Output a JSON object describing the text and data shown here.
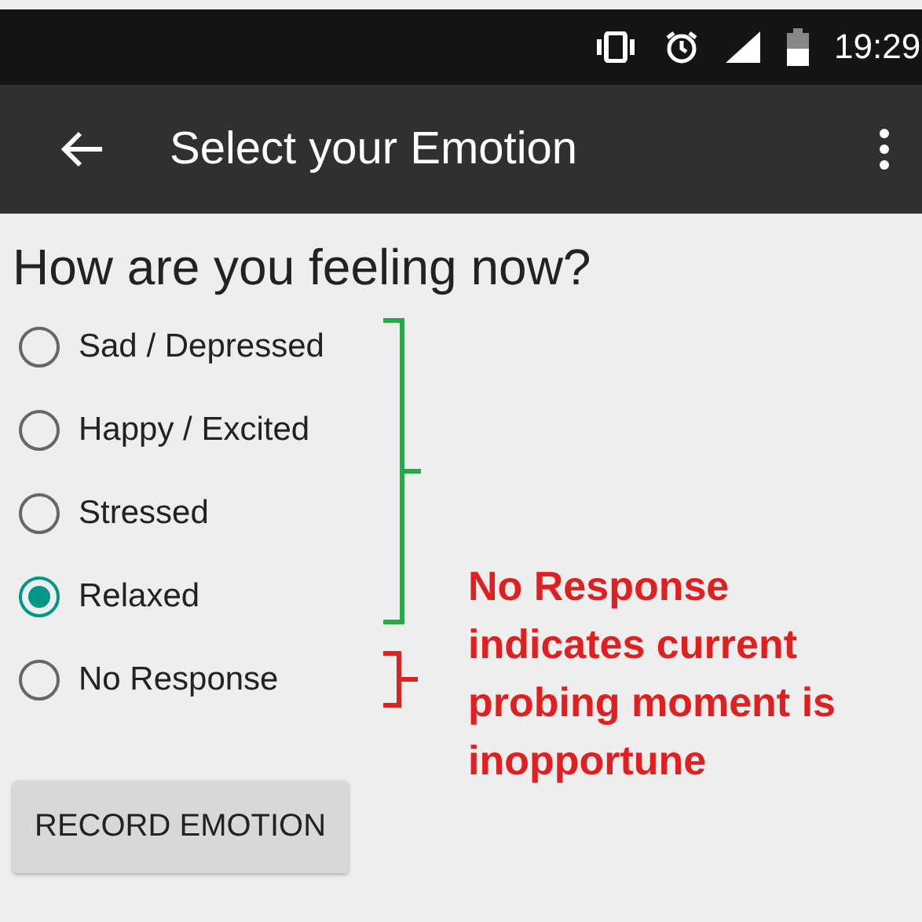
{
  "status_bar": {
    "time": "19:29"
  },
  "app_bar": {
    "title": "Select your Emotion"
  },
  "question": "How are you feeling now?",
  "options": [
    {
      "label": "Sad / Depressed",
      "selected": false
    },
    {
      "label": "Happy / Excited",
      "selected": false
    },
    {
      "label": "Stressed",
      "selected": false
    },
    {
      "label": "Relaxed",
      "selected": true
    },
    {
      "label": "No Response",
      "selected": false
    }
  ],
  "button": "RECORD EMOTION",
  "annotations": [
    {
      "kind": "bracket",
      "color": "#22aa44"
    },
    {
      "kind": "brace",
      "color": "#dd2222"
    }
  ],
  "note": "No Response indicates current probing moment is inopportune"
}
